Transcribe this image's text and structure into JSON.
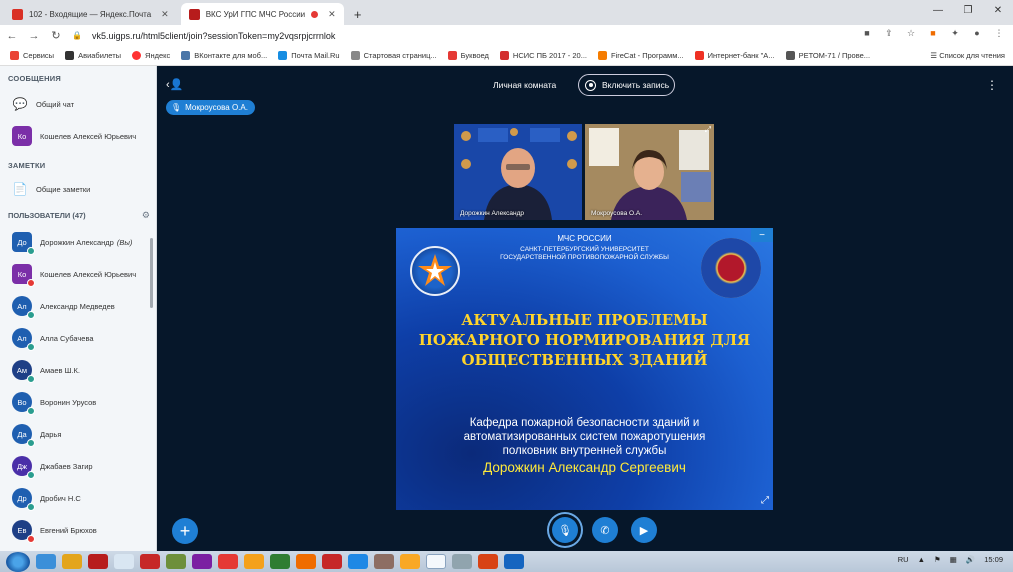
{
  "browser": {
    "tabs": [
      {
        "title": "102 - Входящие — Яндекс.Почта",
        "color": "#d93025"
      },
      {
        "title": "ВКС УрИ ГПС МЧС России",
        "color": "#b71c1c"
      }
    ],
    "url": "vk5.uigps.ru/html5client/join?sessionToken=my2vqsrpjcrrnlok",
    "bookmarks": [
      {
        "label": "Сервисы",
        "color": "#ea4335"
      },
      {
        "label": "Авиабилеты",
        "color": "#333333"
      },
      {
        "label": "Яндекс",
        "color": "#ff3333"
      },
      {
        "label": "ВКонтакте для моб...",
        "color": "#4a76a8"
      },
      {
        "label": "Почта Mail.Ru",
        "color": "#168de2"
      },
      {
        "label": "Стартовая страниц...",
        "color": "#888888"
      },
      {
        "label": "Буквоед",
        "color": "#e53935"
      },
      {
        "label": "НСИС ПБ 2017 - 20...",
        "color": "#d32f2f"
      },
      {
        "label": "FireCat - Программ...",
        "color": "#f57c00"
      },
      {
        "label": "Интернет-банк \"А...",
        "color": "#ef3124"
      },
      {
        "label": "РЕТОМ-71 / Прове...",
        "color": "#555555"
      }
    ],
    "reading_list": "Список для чтения"
  },
  "sidebar": {
    "messages_title": "СООБЩЕНИЯ",
    "public_chat": "Общий чат",
    "private_chat": {
      "initials": "Ко",
      "name": "Кошелев Алексей Юрьевич",
      "color": "#7b2fa8"
    },
    "notes_title": "ЗАМЕТКИ",
    "shared_notes": "Общие заметки",
    "users_title": "ПОЛЬЗОВАТЕЛИ (47)",
    "users": [
      {
        "initials": "До",
        "name": "Дорожкин Александр",
        "suffix": "(Вы)",
        "color": "#1f5fb0",
        "round": false,
        "status": "#2a9d8f"
      },
      {
        "initials": "Ко",
        "name": "Кошелев Алексей Юрьевич",
        "suffix": "",
        "color": "#7b2fa8",
        "round": false,
        "status": "#e53935"
      },
      {
        "initials": "Ал",
        "name": "Александр Медведев",
        "suffix": "",
        "color": "#1f5fb0",
        "round": true,
        "status": "#2a9d8f"
      },
      {
        "initials": "Ал",
        "name": "Алла Субачева",
        "suffix": "",
        "color": "#1f5fb0",
        "round": true,
        "status": "#2a9d8f"
      },
      {
        "initials": "Ам",
        "name": "Амаев Ш.К.",
        "suffix": "",
        "color": "#1e3f86",
        "round": true,
        "status": "#2a9d8f"
      },
      {
        "initials": "Во",
        "name": "Воронин Урусов",
        "suffix": "",
        "color": "#1f5fb0",
        "round": true,
        "status": "#2a9d8f"
      },
      {
        "initials": "Да",
        "name": "Дарья",
        "suffix": "",
        "color": "#1f5fb0",
        "round": true,
        "status": "#2a9d8f"
      },
      {
        "initials": "Дж",
        "name": "Джабаев Загир",
        "suffix": "",
        "color": "#4a2fa8",
        "round": true,
        "status": "#2a9d8f"
      },
      {
        "initials": "Др",
        "name": "Дробич Н.С",
        "suffix": "",
        "color": "#1f5fb0",
        "round": true,
        "status": "#2a9d8f"
      },
      {
        "initials": "Ев",
        "name": "Евгений Брюхов",
        "suffix": "",
        "color": "#1e3f86",
        "round": true,
        "status": "#e53935"
      }
    ]
  },
  "main": {
    "room_title": "Личная комната",
    "record_label": "Включить запись",
    "talking": "Мокроусова О.А.",
    "videos": [
      {
        "name": "Дорожкин Александр"
      },
      {
        "name": "Мокроусова О.А."
      }
    ],
    "slide": {
      "org1": "МЧС РОССИИ",
      "org2": "САНКТ-ПЕТЕРБУРГСКИЙ УНИВЕРСИТЕТ ГОСУДАРСТВЕННОЙ ПРОТИВОПОЖАРНОЙ СЛУЖБЫ",
      "title_lines": [
        "АКТУАЛЬНЫЕ ПРОБЛЕМЫ",
        "ПОЖАРНОГО НОРМИРОВАНИЯ ДЛЯ",
        "ОБЩЕСТВЕННЫХ ЗДАНИЙ"
      ],
      "sub_lines": [
        "Кафедра пожарной безопасности зданий и",
        "автоматизированных систем пожаротушения",
        "полковник внутренней службы"
      ],
      "author": "Дорожкин Александр Сергеевич"
    }
  },
  "taskbar": {
    "lang": "RU",
    "time": "15:09"
  }
}
